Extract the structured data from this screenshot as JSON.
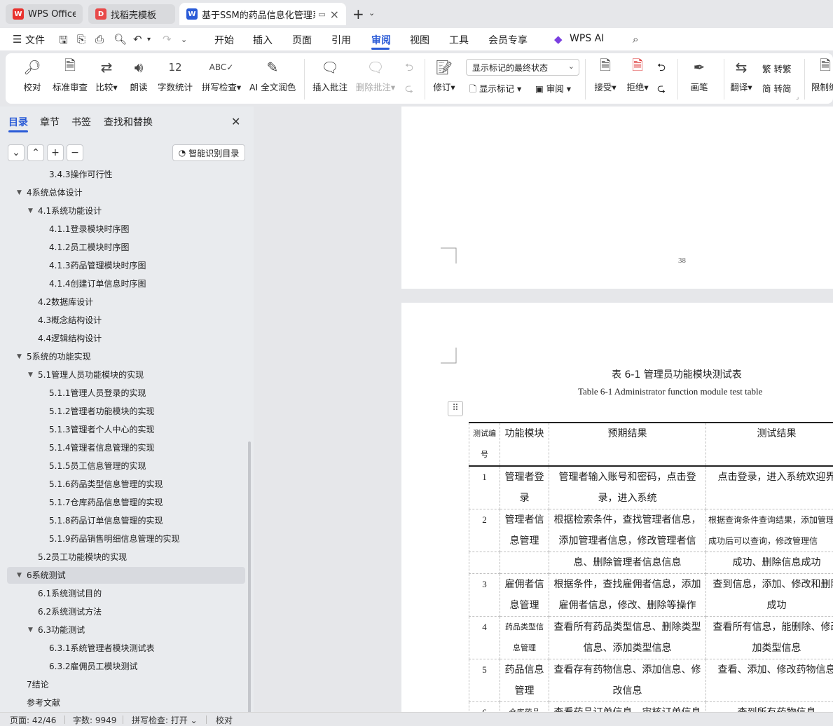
{
  "tabs": [
    {
      "label": "WPS Office",
      "logo": "wps-logo-icon",
      "color": "#e8322e"
    },
    {
      "label": "找稻壳模板",
      "logo": "docer-logo-icon",
      "color": "#e84a4a"
    },
    {
      "label": "基于SSM的药品信息化管理系",
      "logo": "writer-doc-icon",
      "color": "#2a5bd7"
    }
  ],
  "menu": {
    "file": "文件",
    "items": [
      "开始",
      "插入",
      "页面",
      "引用",
      "审阅",
      "视图",
      "工具",
      "会员专享"
    ],
    "active": "审阅",
    "wps_ai": "WPS AI"
  },
  "ribbon": {
    "proofread": "校对",
    "standard_review": "标准审查",
    "compare": "比较",
    "read_aloud": "朗读",
    "word_count": "字数统计",
    "spell_check": "拼写检查",
    "ai_polish": "AI 全文润色",
    "insert_comment": "插入批注",
    "delete_comment": "删除批注",
    "track_changes": "修订",
    "markup_mode": "显示标记的最终状态",
    "show_markup": "显示标记",
    "review": "审阅",
    "accept": "接受",
    "reject": "拒绝",
    "ink": "画笔",
    "translate": "翻译",
    "to_traditional": "转繁",
    "to_simplified": "转简",
    "restrict": "限制编"
  },
  "sidebar": {
    "tabs": [
      "目录",
      "章节",
      "书签",
      "查找和替换"
    ],
    "smart_toc": "智能识别目录",
    "toc": [
      {
        "label": "3.4.3操作可行性",
        "level": 3,
        "tri": false
      },
      {
        "label": "4系统总体设计",
        "level": 1,
        "tri": true
      },
      {
        "label": "4.1系统功能设计",
        "level": 2,
        "tri": true
      },
      {
        "label": "4.1.1登录模块时序图",
        "level": 3,
        "tri": false
      },
      {
        "label": "4.1.2员工模块时序图",
        "level": 3,
        "tri": false
      },
      {
        "label": "4.1.3药品管理模块时序图",
        "level": 3,
        "tri": false
      },
      {
        "label": "4.1.4创建订单信息时序图",
        "level": 3,
        "tri": false
      },
      {
        "label": "4.2数据库设计",
        "level": 2,
        "tri": false
      },
      {
        "label": "4.3概念结构设计",
        "level": 2,
        "tri": false
      },
      {
        "label": "4.4逻辑结构设计",
        "level": 2,
        "tri": false
      },
      {
        "label": "5系统的功能实现",
        "level": 1,
        "tri": true
      },
      {
        "label": "5.1管理人员功能模块的实现",
        "level": 2,
        "tri": true
      },
      {
        "label": "5.1.1管理人员登录的实现",
        "level": 3,
        "tri": false
      },
      {
        "label": "5.1.2管理者功能模块的实现",
        "level": 3,
        "tri": false
      },
      {
        "label": "5.1.3管理者个人中心的实现",
        "level": 3,
        "tri": false
      },
      {
        "label": "5.1.4管理者信息管理的实现",
        "level": 3,
        "tri": false
      },
      {
        "label": "5.1.5员工信息管理的实现",
        "level": 3,
        "tri": false
      },
      {
        "label": "5.1.6药品类型信息管理的实现",
        "level": 3,
        "tri": false
      },
      {
        "label": "5.1.7仓库药品信息管理的实现",
        "level": 3,
        "tri": false
      },
      {
        "label": "5.1.8药品订单信息管理的实现",
        "level": 3,
        "tri": false
      },
      {
        "label": "5.1.9药品销售明细信息管理的实现",
        "level": 3,
        "tri": false
      },
      {
        "label": "5.2员工功能模块的实现",
        "level": 2,
        "tri": false
      },
      {
        "label": "6系统测试",
        "level": 1,
        "tri": true,
        "selected": true
      },
      {
        "label": "6.1系统测试目的",
        "level": 2,
        "tri": false
      },
      {
        "label": "6.2系统测试方法",
        "level": 2,
        "tri": false
      },
      {
        "label": "6.3功能测试",
        "level": 2,
        "tri": true
      },
      {
        "label": "6.3.1系统管理者模块测试表",
        "level": 3,
        "tri": false
      },
      {
        "label": "6.3.2雇佣员工模块测试",
        "level": 3,
        "tri": false
      },
      {
        "label": "7结论",
        "level": 1,
        "tri": false
      },
      {
        "label": "参考文献",
        "level": 1,
        "tri": false
      }
    ]
  },
  "document": {
    "page_number": "38",
    "table_caption_cn": "表 6-1  管理员功能模块测试表",
    "table_caption_en": "Table 6-1 Administrator function module test table",
    "headers": [
      "测试编号",
      "功能模块",
      "预期结果",
      "测试结果"
    ],
    "rows": [
      [
        "1",
        "管理者登录",
        "管理者输入账号和密码，点击登录，进入系统",
        "点击登录，进入系统欢迎界"
      ],
      [
        "2",
        "管理者信息管理",
        "根据检索条件，查找管理者信息，添加管理者信息，修改管理者信",
        "根据查询条件查询结果，添加管理者成功后可以查询，修改管理信"
      ],
      [
        "",
        "",
        "息、删除管理者信息信息",
        "成功、删除信息成功"
      ],
      [
        "3",
        "雇佣者信息管理",
        "根据条件，查找雇佣者信息，添加雇佣者信息，修改、删除等操作",
        "查到信息，添加、修改和删除成功"
      ],
      [
        "4",
        "药品类型信息管理",
        "查看所有药品类型信息、删除类型信息、添加类型信息",
        "查看所有信息，能删除、修改加类型信息"
      ],
      [
        "5",
        "药品信息管理",
        "查看存有药物信息、添加信息、修改信息",
        "查看、添加、修改药物信息"
      ],
      [
        "6",
        "仓库药品",
        "查看药品订单信息、审核订单信息",
        "查到所有药物信息"
      ]
    ]
  },
  "status": {
    "page": "页面: 42/46",
    "words": "字数: 9949",
    "spell": "拼写检查: 打开",
    "proof": "校对"
  },
  "colors": {
    "accent": "#2a5bd7"
  }
}
